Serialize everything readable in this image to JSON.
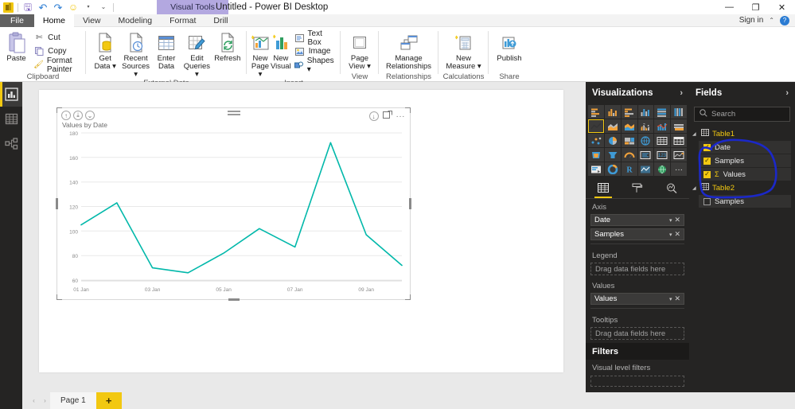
{
  "titlebar": {
    "app_icon": "powerbi-logo-icon",
    "quick_access": [
      {
        "name": "save-icon",
        "glyph": "🖫",
        "label": "Save"
      },
      {
        "name": "undo-icon",
        "glyph": "↶",
        "label": "Undo"
      },
      {
        "name": "redo-icon",
        "glyph": "↷",
        "label": "Redo"
      },
      {
        "name": "feedback-smiley-icon",
        "glyph": "☺",
        "label": "Send a Smile"
      },
      {
        "name": "customize-qat-icon",
        "glyph": "▾",
        "label": "Customize Quick Access Toolbar"
      }
    ],
    "contextual_group": "Visual Tools",
    "document_title": "Untitled - Power BI Desktop",
    "minimize": "—",
    "restore": "❐",
    "close": "✕",
    "sign_in": "Sign in",
    "collapse_ribbon": "⌃",
    "help": "?"
  },
  "ribbon": {
    "tabs": [
      {
        "label": "File",
        "state": "file"
      },
      {
        "label": "Home",
        "state": "active"
      },
      {
        "label": "View",
        "state": "normal"
      },
      {
        "label": "Modeling",
        "state": "normal"
      },
      {
        "label": "Format",
        "state": "contextual"
      },
      {
        "label": "Drill",
        "state": "contextual"
      }
    ],
    "groups": [
      {
        "name": "clipboard",
        "label": "Clipboard",
        "big": [
          {
            "label_line1": "Paste",
            "label_line2": "",
            "icon": "paste-icon"
          }
        ],
        "small": [
          {
            "label": "Cut",
            "icon": "cut-scissors-icon"
          },
          {
            "label": "Copy",
            "icon": "copy-icon"
          },
          {
            "label": "Format Painter",
            "icon": "format-painter-icon"
          }
        ]
      },
      {
        "name": "external-data",
        "label": "External Data",
        "big": [
          {
            "label_line1": "Get",
            "label_line2": "Data ▾",
            "icon": "get-data-icon"
          },
          {
            "label_line1": "Recent",
            "label_line2": "Sources ▾",
            "icon": "recent-sources-icon"
          },
          {
            "label_line1": "Enter",
            "label_line2": "Data",
            "icon": "enter-data-icon"
          },
          {
            "label_line1": "Edit",
            "label_line2": "Queries ▾",
            "icon": "edit-queries-icon"
          },
          {
            "label_line1": "Refresh",
            "label_line2": "",
            "icon": "refresh-icon"
          }
        ],
        "small": []
      },
      {
        "name": "insert",
        "label": "Insert",
        "big": [
          {
            "label_line1": "New",
            "label_line2": "Page ▾",
            "icon": "new-page-icon"
          },
          {
            "label_line1": "New",
            "label_line2": "Visual",
            "icon": "new-visual-icon"
          }
        ],
        "small": [
          {
            "label": "Text Box",
            "icon": "text-box-icon"
          },
          {
            "label": "Image",
            "icon": "image-icon"
          },
          {
            "label": "Shapes ▾",
            "icon": "shapes-icon"
          }
        ]
      },
      {
        "name": "view",
        "label": "View",
        "big": [
          {
            "label_line1": "Page",
            "label_line2": "View ▾",
            "icon": "page-view-icon"
          }
        ],
        "small": []
      },
      {
        "name": "relationships",
        "label": "Relationships",
        "big": [
          {
            "label_line1": "Manage",
            "label_line2": "Relationships",
            "icon": "manage-relationships-icon"
          }
        ],
        "small": []
      },
      {
        "name": "calculations",
        "label": "Calculations",
        "big": [
          {
            "label_line1": "New",
            "label_line2": "Measure ▾",
            "icon": "new-measure-icon"
          }
        ],
        "small": []
      },
      {
        "name": "share",
        "label": "Share",
        "big": [
          {
            "label_line1": "Publish",
            "label_line2": "",
            "icon": "publish-icon"
          }
        ],
        "small": []
      }
    ]
  },
  "viewbar": {
    "items": [
      {
        "name": "report-view",
        "icon": "bar-chart-icon",
        "active": true
      },
      {
        "name": "data-view",
        "icon": "table-grid-icon",
        "active": false
      },
      {
        "name": "model-view",
        "icon": "relationships-model-icon",
        "active": false
      }
    ]
  },
  "visual": {
    "title": "Values by Date",
    "drill_buttons": [
      {
        "name": "drill-up-icon",
        "glyph": "↑"
      },
      {
        "name": "drill-down-mode-icon",
        "glyph": "⤓"
      },
      {
        "name": "expand-hierarchy-icon",
        "glyph": "⌄"
      }
    ],
    "action_buttons": [
      {
        "name": "drill-through-icon",
        "glyph": "↓"
      },
      {
        "name": "focus-mode-icon",
        "glyph": "⧉"
      },
      {
        "name": "more-options-icon",
        "glyph": "···"
      }
    ]
  },
  "chart_data": {
    "type": "line",
    "title": "Values by Date",
    "xlabel": "",
    "ylabel": "",
    "grid": true,
    "legend": "none",
    "line_color": "#01B8AA",
    "ylim": [
      60,
      180
    ],
    "yticks": [
      180,
      160,
      140,
      120,
      100,
      80,
      60
    ],
    "xticks": [
      "01 Jan",
      "03 Jan",
      "05 Jan",
      "07 Jan",
      "09 Jan"
    ],
    "x": [
      "01 Jan",
      "02 Jan",
      "03 Jan",
      "04 Jan",
      "05 Jan",
      "06 Jan",
      "07 Jan",
      "08 Jan",
      "09 Jan",
      "10 Jan"
    ],
    "series": [
      {
        "name": "Values",
        "values": [
          105,
          123,
          70,
          66,
          82,
          102,
          87,
          172,
          97,
          72
        ]
      }
    ]
  },
  "visualizations": {
    "header": "Visualizations",
    "chevron": "›",
    "gallery": [
      {
        "name": "stacked-bar-chart-icon",
        "selected": false
      },
      {
        "name": "stacked-column-chart-icon",
        "selected": false
      },
      {
        "name": "clustered-bar-chart-icon",
        "selected": false
      },
      {
        "name": "clustered-column-chart-icon",
        "selected": false
      },
      {
        "name": "100-stacked-bar-chart-icon",
        "selected": false
      },
      {
        "name": "100-stacked-column-chart-icon",
        "selected": false
      },
      {
        "name": "line-chart-icon",
        "selected": true
      },
      {
        "name": "area-chart-icon",
        "selected": false
      },
      {
        "name": "stacked-area-chart-icon",
        "selected": false
      },
      {
        "name": "line-stacked-column-chart-icon",
        "selected": false
      },
      {
        "name": "line-clustered-column-chart-icon",
        "selected": false
      },
      {
        "name": "ribbon-chart-icon",
        "selected": false
      },
      {
        "name": "scatter-chart-icon",
        "selected": false
      },
      {
        "name": "pie-chart-icon",
        "selected": false
      },
      {
        "name": "treemap-icon",
        "selected": false
      },
      {
        "name": "map-icon",
        "selected": false
      },
      {
        "name": "table-icon",
        "selected": false
      },
      {
        "name": "matrix-icon",
        "selected": false
      },
      {
        "name": "filled-map-icon",
        "selected": false
      },
      {
        "name": "funnel-chart-icon",
        "selected": false
      },
      {
        "name": "gauge-icon",
        "selected": false
      },
      {
        "name": "multi-row-card-icon",
        "selected": false
      },
      {
        "name": "card-icon",
        "selected": false
      },
      {
        "name": "kpi-icon",
        "selected": false
      },
      {
        "name": "slicer-icon",
        "selected": false
      },
      {
        "name": "donut-chart-icon",
        "selected": false
      },
      {
        "name": "r-script-visual-icon",
        "selected": false
      },
      {
        "name": "arcgis-map-icon",
        "selected": false
      },
      {
        "name": "globe-map-icon",
        "selected": false
      },
      {
        "name": "more-visuals-icon",
        "selected": false
      }
    ],
    "tabs": [
      {
        "name": "fields-tab",
        "icon": "fields-grid-icon",
        "active": true
      },
      {
        "name": "format-tab",
        "icon": "paint-roller-icon",
        "active": false
      },
      {
        "name": "analytics-tab",
        "icon": "magnifier-analytics-icon",
        "active": false
      }
    ],
    "wells": [
      {
        "label": "Axis",
        "chips": [
          {
            "name": "Date",
            "dropdown": "▾",
            "remove": "✕"
          },
          {
            "name": "Samples",
            "dropdown": "▾",
            "remove": "✕"
          }
        ],
        "placeholder": null
      },
      {
        "label": "Legend",
        "chips": [],
        "placeholder": "Drag data fields here"
      },
      {
        "label": "Values",
        "chips": [
          {
            "name": "Values",
            "dropdown": "▾",
            "remove": "✕"
          }
        ],
        "placeholder": null
      },
      {
        "label": "Tooltips",
        "chips": [],
        "placeholder": "Drag data fields here"
      }
    ],
    "filters": {
      "header": "Filters",
      "visual_level": "Visual level filters"
    }
  },
  "fields": {
    "header": "Fields",
    "chevron": "›",
    "search_placeholder": "Search",
    "search_icon": "search-icon",
    "tables": [
      {
        "name": "Table1",
        "expander": "▲",
        "fields": [
          {
            "label": "Date",
            "checked": true,
            "measure": false
          },
          {
            "label": "Samples",
            "checked": true,
            "measure": false
          },
          {
            "label": "Values",
            "checked": true,
            "measure": true,
            "sigma": "Σ"
          }
        ]
      },
      {
        "name": "Table2",
        "expander": "▲",
        "fields": [
          {
            "label": "Samples",
            "checked": false,
            "measure": false
          }
        ]
      }
    ],
    "annotation": {
      "type": "hand-drawn-ellipse",
      "color": "#1b28c8",
      "target": "Table1 fields group"
    }
  },
  "bottombar": {
    "prev_page": "‹",
    "next_page": "›",
    "pages": [
      {
        "label": "Page 1",
        "active": true
      }
    ],
    "add_page": "+"
  }
}
